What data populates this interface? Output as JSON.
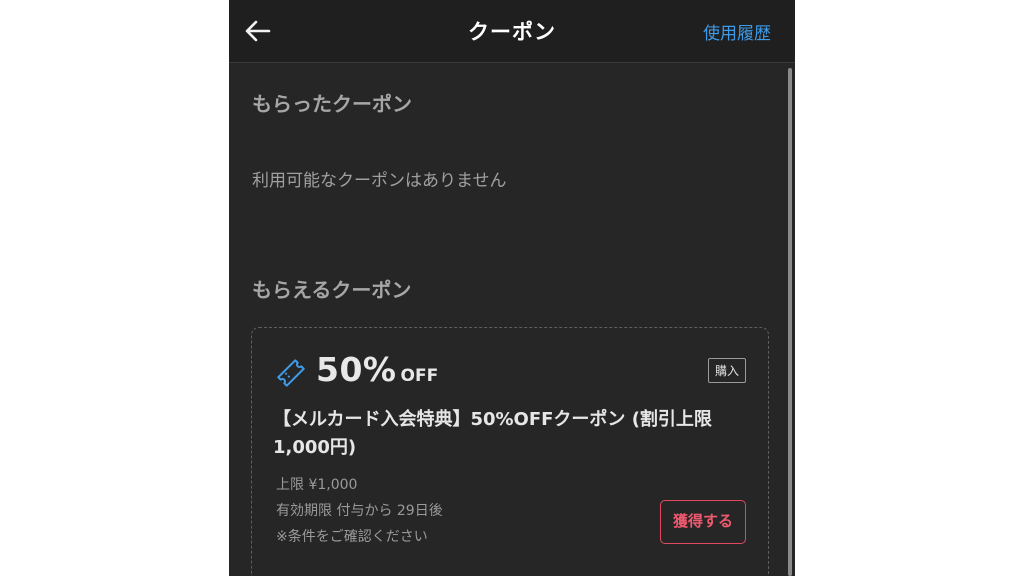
{
  "header": {
    "title": "クーポン",
    "history_link": "使用履歴"
  },
  "received": {
    "title": "もらったクーポン",
    "empty_message": "利用可能なクーポンはありません"
  },
  "available": {
    "title": "もらえるクーポン",
    "coupons": [
      {
        "discount_value": "50%",
        "discount_suffix": "OFF",
        "badge": "購入",
        "name": "【メルカード入会特典】50%OFFクーポン (割引上限1,000円)",
        "limit": "上限 ¥1,000",
        "expiry": "有効期限 付与から 29日後",
        "note": "※条件をご確認ください",
        "action_label": "獲得する"
      }
    ]
  },
  "colors": {
    "accent_link": "#3d9be9",
    "action": "#e0485f",
    "icon": "#3d9be9"
  },
  "icons": {
    "back": "arrow-left-icon",
    "coupon": "ticket-icon"
  }
}
